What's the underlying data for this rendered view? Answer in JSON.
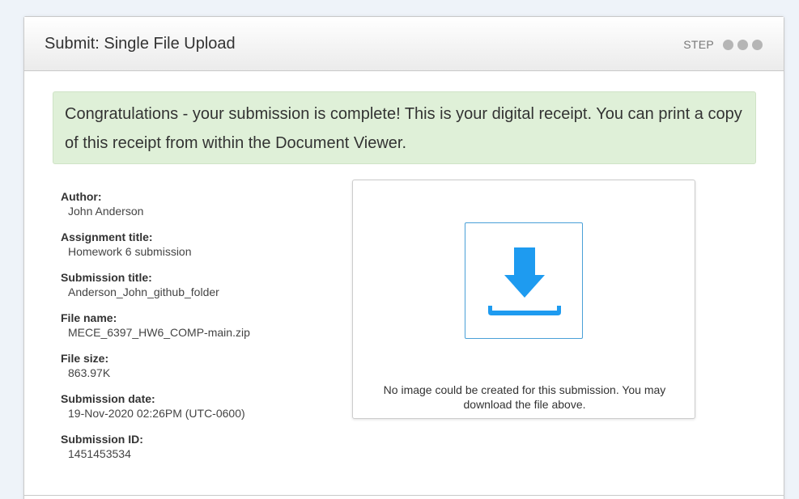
{
  "header": {
    "title": "Submit: Single File Upload",
    "step_label": "STEP"
  },
  "alert": {
    "message": "Congratulations - your submission is complete! This is your digital receipt. You can print a copy of this receipt from within the Document Viewer."
  },
  "receipt": {
    "author_label": "Author:",
    "author": "John Anderson",
    "assignment_label": "Assignment title:",
    "assignment": "Homework 6 submission",
    "submission_title_label": "Submission title:",
    "submission_title": "Anderson_John_github_folder",
    "file_name_label": "File name:",
    "file_name": "MECE_6397_HW6_COMP-main.zip",
    "file_size_label": "File size:",
    "file_size": "863.97K",
    "submission_date_label": "Submission date:",
    "submission_date": "19-Nov-2020 02:26PM (UTC-0600)",
    "submission_id_label": "Submission ID:",
    "submission_id": "1451453534"
  },
  "preview": {
    "icon": "download-icon",
    "no_image_text": "No image could be created for this submission. You may download the file above."
  },
  "colors": {
    "accent": "#1e9bf0",
    "success_bg": "#dff0d8",
    "step_dot": "#b5b5b5"
  }
}
